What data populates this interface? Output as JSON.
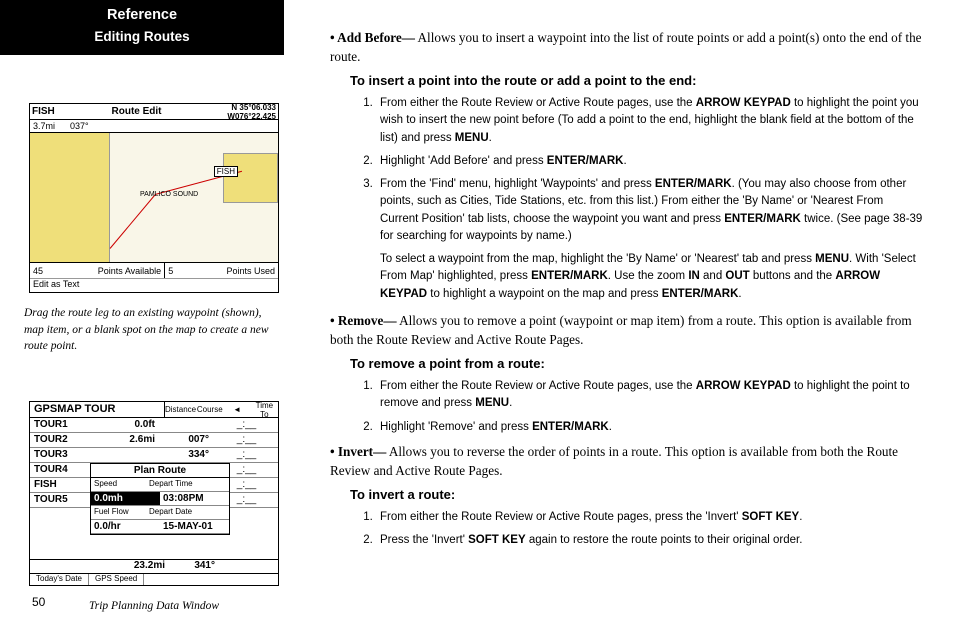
{
  "header": {
    "line1": "Reference",
    "line2": "Editing Routes"
  },
  "fig1": {
    "title": "Route Edit",
    "nav_label": "FISH",
    "distance": "3.7mi",
    "bearing": "037°",
    "coords": "N 35°06.033\nW076°22.425",
    "waypoint_label": "FISH",
    "sound_label": "PAMLICO SOUND",
    "pts_avail_n": "45",
    "pts_avail_t": "Points Available",
    "pts_used_n": "5",
    "pts_used_t": "Points Used",
    "editbar": "Edit as Text"
  },
  "caption1": "Drag the route leg to an existing waypoint (shown), map item, or a blank spot on the map to create a new route point.",
  "fig2": {
    "title": "GPSMAP  TOUR",
    "cols": {
      "c1": "Distance",
      "c2": "Course",
      "c3": "◄",
      "c4": "Time To"
    },
    "rows": [
      {
        "name": "TOUR1",
        "dist": "0.0ft",
        "course": "",
        "time": "_:__"
      },
      {
        "name": "TOUR2",
        "dist": "2.6mi",
        "course": "007°",
        "time": "_:__"
      },
      {
        "name": "TOUR3",
        "dist": "",
        "course": "334°",
        "time": "_:__"
      },
      {
        "name": "TOUR4",
        "dist": "",
        "course": "",
        "time": "_:__"
      },
      {
        "name": "FISH",
        "dist": "",
        "course": "",
        "time": "_:__"
      },
      {
        "name": "TOUR5",
        "dist": "",
        "course": "",
        "time": "_:__"
      }
    ],
    "plan": {
      "title": "Plan Route",
      "r1l": "Speed",
      "r1v": "0.0mh",
      "r2l": "Depart Time",
      "r2v": "03:08PM",
      "r3l": "Fuel Flow",
      "r3v": "0.0/hr",
      "r4l": "Depart Date",
      "r4v": "15-MAY-01"
    },
    "tot_dist": "23.2mi",
    "tot_course": "341°",
    "bbar1": "Today's Date",
    "bbar2": "GPS Speed"
  },
  "caption2": "Trip Planning Data Window",
  "content": {
    "addbefore_label": "• Add Before—",
    "addbefore_text": " Allows you to insert a waypoint into the list of route points or add a point(s) onto the end of the route.",
    "h1": "To insert a point into the route or add a point to the end:",
    "li1a": "From either the Route Review or Active Route pages, use the ",
    "li1b": "ARROW KEYPAD",
    "li1c": " to highlight the point you wish to insert the new point before (To add a point to the end, highlight the blank field at the bottom of the list) and press ",
    "li1d": "MENU",
    "li1e": ".",
    "li2a": "Highlight 'Add Before' and press ",
    "li2b": "ENTER/MARK",
    "li2c": ".",
    "li3a": "From the 'Find' menu, highlight 'Waypoints' and press ",
    "li3b": "ENTER/MARK",
    "li3c": ". (You may also choose from other points, such as Cities, Tide Stations, etc. from this list.) From either the 'By Name' or 'Nearest From Current Position' tab lists, choose the waypoint you want and press ",
    "li3d": "ENTER/MARK",
    "li3e": " twice. (See page 38-39 for searching for waypoints by name.)",
    "p2a": "To select a waypoint from the map, highlight the 'By Name' or 'Nearest' tab and press ",
    "p2b": "MENU",
    "p2c": ". With 'Select From Map' highlighted, press ",
    "p2d": "ENTER/MARK",
    "p2e": ". Use the zoom ",
    "p2f": "IN",
    "p2g": " and ",
    "p2h": "OUT",
    "p2i": " buttons and the ",
    "p2j": "ARROW KEYPAD",
    "p2k": " to highlight a waypoint on the map and press ",
    "p2l": "ENTER/MARK",
    "p2m": ".",
    "remove_label": "• Remove—",
    "remove_text": " Allows you to remove a point (waypoint or map item) from a route. This option is available from both the Route Review and Active Route Pages.",
    "h2": "To remove a point from a route:",
    "r_li1a": "From either the Route Review or Active Route pages, use the ",
    "r_li1b": "ARROW KEYPAD",
    "r_li1c": " to highlight the point to remove and press ",
    "r_li1d": "MENU",
    "r_li1e": ".",
    "r_li2a": "Highlight 'Remove' and press ",
    "r_li2b": "ENTER/MARK",
    "r_li2c": ".",
    "invert_label": "• Invert—",
    "invert_text": " Allows you to reverse the order of points in a route. This option is available from both the Route Review and Active Route Pages.",
    "h3": "To invert a route:",
    "i_li1a": "From either the Route Review or Active Route pages, press the 'Invert' ",
    "i_li1b": "SOFT KEY",
    "i_li1c": ".",
    "i_li2a": "Press the 'Invert' ",
    "i_li2b": "SOFT KEY",
    "i_li2c": " again to restore the route points to their original order."
  },
  "page_num": "50"
}
